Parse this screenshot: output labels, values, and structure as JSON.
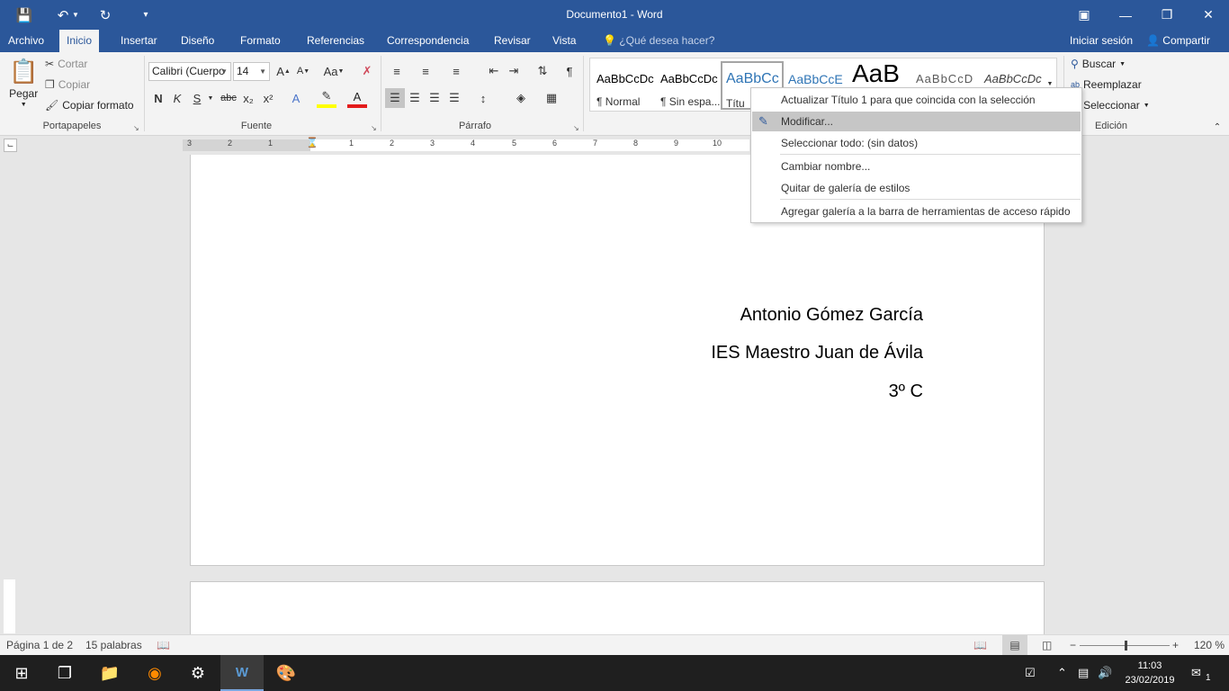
{
  "window": {
    "title": "Documento1 - Word",
    "quick_access": {
      "save_icon": "save-icon",
      "undo_icon": "undo-icon",
      "redo_icon": "redo-icon",
      "customize_icon": "customize-qat-icon"
    }
  },
  "tabs": [
    {
      "label": "Archivo"
    },
    {
      "label": "Inicio"
    },
    {
      "label": "Insertar"
    },
    {
      "label": "Diseño"
    },
    {
      "label": "Formato"
    },
    {
      "label": "Referencias"
    },
    {
      "label": "Correspondencia"
    },
    {
      "label": "Revisar"
    },
    {
      "label": "Vista"
    }
  ],
  "help_search": "¿Qué desea hacer?",
  "account": {
    "signin": "Iniciar sesión",
    "share": "Compartir"
  },
  "ribbon": {
    "clipboard": {
      "paste": "Pegar",
      "cut": "Cortar",
      "copy": "Copiar",
      "format_painter": "Copiar formato",
      "label": "Portapapeles"
    },
    "font": {
      "name": "Calibri (Cuerpo",
      "size": "14",
      "label": "Fuente",
      "bold": "N",
      "italic": "K",
      "underline": "S",
      "strike": "abc",
      "sub": "x₂",
      "sup": "x²",
      "grow": "A",
      "shrink": "A",
      "case": "Aa"
    },
    "paragraph": {
      "label": "Párrafo",
      "pilcrow": "¶"
    },
    "styles": [
      {
        "sample": "AaBbCcDc",
        "name": "¶ Normal"
      },
      {
        "sample": "AaBbCcDc",
        "name": "¶ Sin espa..."
      },
      {
        "sample": "AaBbCc",
        "name": "Títu"
      },
      {
        "sample": "AaBbCcE",
        "name": ""
      },
      {
        "sample": "AaB",
        "name": ""
      },
      {
        "sample": "AaBbCcD",
        "name": ""
      },
      {
        "sample": "AaBbCcDc",
        "name": ""
      }
    ],
    "editing": {
      "find": "Buscar",
      "replace": "Reemplazar",
      "select": "Seleccionar",
      "label": "Edición"
    }
  },
  "ruler": {
    "numbers": [
      "3",
      "2",
      "1",
      "1",
      "2",
      "3",
      "4",
      "5",
      "6",
      "7",
      "8",
      "9",
      "10"
    ]
  },
  "document": {
    "lines": [
      "Antonio Gómez García",
      "IES Maestro Juan de Ávila",
      "3º C"
    ]
  },
  "context_menu": {
    "items": [
      {
        "label": "Actualizar Título 1 para que coincida con la selección"
      },
      {
        "label": "Modificar..."
      },
      {
        "label": "Seleccionar todo: (sin datos)"
      },
      {
        "label": "Cambiar nombre..."
      },
      {
        "label": "Quitar de galería de estilos"
      },
      {
        "label": "Agregar galería a la barra de herramientas de acceso rápido"
      }
    ]
  },
  "status": {
    "page": "Página 1 de 2",
    "words": "15 palabras",
    "zoom": "120 %"
  },
  "taskbar": {
    "time": "11:03",
    "date": "23/02/2019",
    "notifications": "1"
  }
}
